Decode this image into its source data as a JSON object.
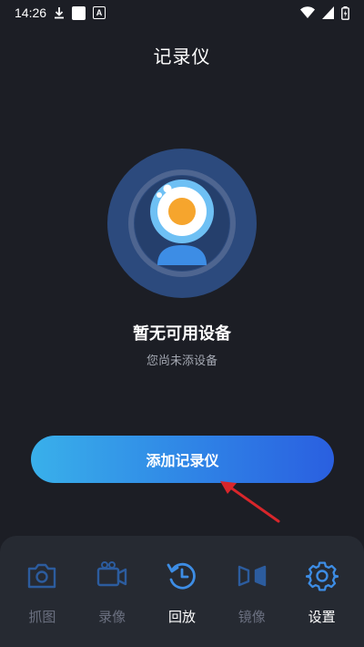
{
  "status_bar": {
    "time": "14:26",
    "notif_letter": "A"
  },
  "header": {
    "title": "记录仪"
  },
  "empty_state": {
    "title": "暂无可用设备",
    "subtitle": "您尚未添设备"
  },
  "add_button": {
    "label": "添加记录仪"
  },
  "bottom_nav": {
    "items": [
      {
        "label": "抓图",
        "icon": "camera-icon"
      },
      {
        "label": "录像",
        "icon": "video-camera-icon"
      },
      {
        "label": "回放",
        "icon": "replay-clock-icon"
      },
      {
        "label": "镜像",
        "icon": "mirror-icon"
      },
      {
        "label": "设置",
        "icon": "gear-icon"
      }
    ]
  },
  "colors": {
    "background": "#1c1e25",
    "nav_background": "#262a32",
    "accent_blue": "#2f83e6",
    "inactive": "#6b7080",
    "arrow_red": "#d8262b"
  }
}
